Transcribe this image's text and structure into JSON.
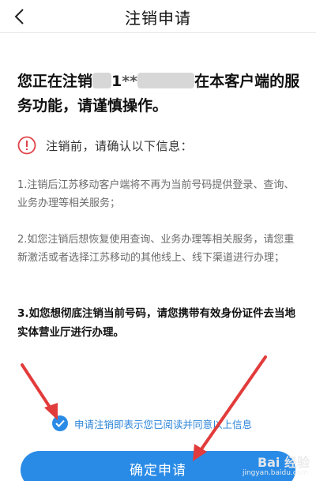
{
  "header": {
    "title": "注销申请",
    "back_icon": "chevron-left-icon"
  },
  "headline": {
    "part1": "您正在注销",
    "digit": "1",
    "stars": "**",
    "part2": "在本客户端的服务功能，请谨慎操作。"
  },
  "notice": {
    "icon": "exclamation-circle-icon",
    "text": "注销前，请确认以下信息："
  },
  "items": [
    "1.注销后江苏移动客户端将不再为当前号码提供登录、查询、业务办理等相关服务；",
    "2.如您注销后想恢复使用查询、业务办理等相关服务，请您重新激活或者选择江苏移动的其他线上、线下渠道进行办理；",
    "3.如您想彻底注销当前号码，请您携带有效身份证件去当地实体营业厅进行办理。"
  ],
  "agreement": {
    "checked": true,
    "text": "申请注销即表示您已阅读并同意以上信息"
  },
  "confirm_button": {
    "label": "确定申请"
  },
  "watermark": {
    "main": "Bai 经验",
    "sub": "jingyan.baidu.com"
  },
  "colors": {
    "accent": "#2a8be6",
    "warning": "#e0434a",
    "annotation_arrow": "#e23b3b"
  }
}
